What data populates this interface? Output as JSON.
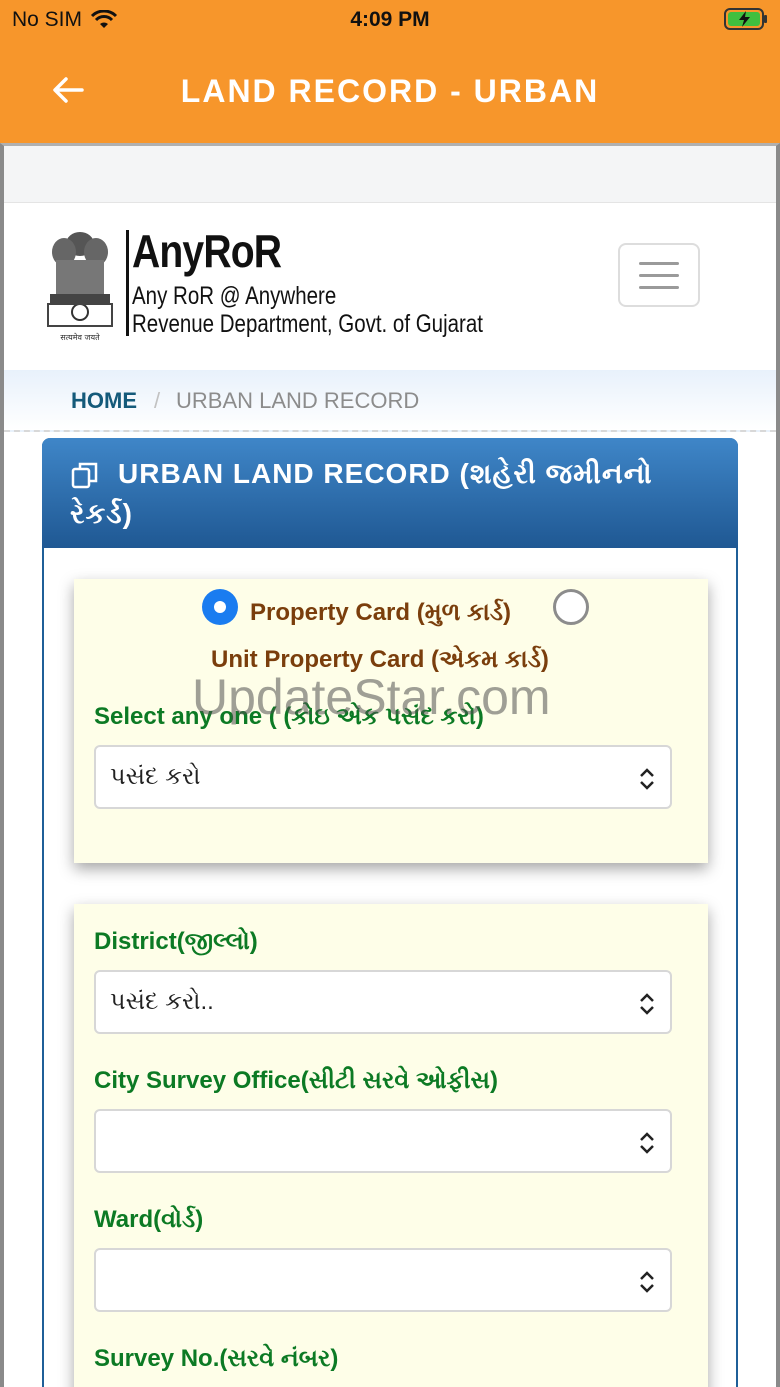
{
  "status_bar": {
    "carrier": "No SIM",
    "time": "4:09 PM"
  },
  "app_bar": {
    "title": "LAND RECORD - URBAN"
  },
  "brand": {
    "name": "AnyRoR",
    "line1": "Any RoR @ Anywhere",
    "line2": "Revenue Department, Govt. of Gujarat",
    "emblem_caption": "सत्यमेव जयते"
  },
  "breadcrumb": {
    "home": "HOME",
    "separator": "/",
    "current": "URBAN LAND RECORD"
  },
  "panel": {
    "title": "URBAN LAND RECORD (શહેરી જમીનનો રેકર્ડ)"
  },
  "record_type": {
    "option1": "Property Card (મુળ કાર્ડ)",
    "option2": "Unit Property Card (એકમ કાર્ડ)",
    "selected": "option1"
  },
  "select_any": {
    "label": "Select any one ( (કોઇ એક પસંદ કરો)",
    "value": "પસંદ કરો"
  },
  "district": {
    "label": "District(જીલ્લો)",
    "value": "પસંદ કરો.."
  },
  "city_survey_office": {
    "label": "City Survey Office(સીટી સરવે ઓફીસ)",
    "value": ""
  },
  "ward": {
    "label": "Ward(વોર્ડ)",
    "value": ""
  },
  "survey_no": {
    "label": "Survey No.(સરવે નંબર)"
  },
  "watermark": "UpdateStar.com",
  "colors": {
    "app_bar": "#f7962b",
    "panel_header": "#2a6aab",
    "label_green": "#0c7a24",
    "label_brown": "#7a3e0c",
    "card_bg": "#fefee8"
  }
}
